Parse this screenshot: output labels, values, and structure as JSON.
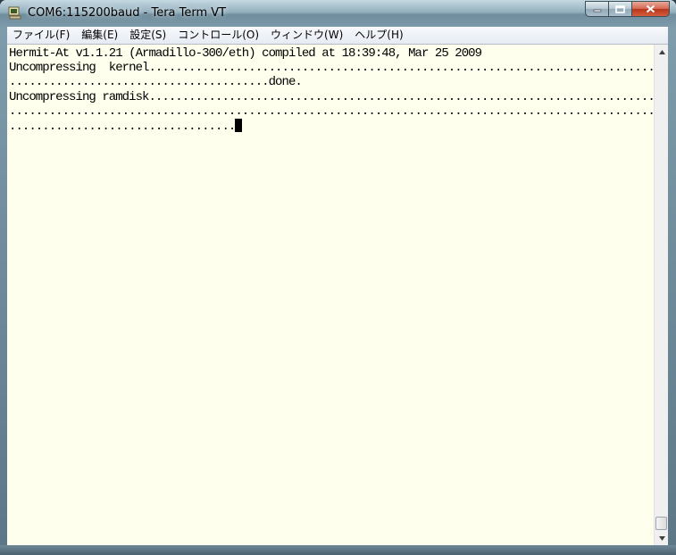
{
  "window": {
    "title": "COM6:115200baud - Tera Term VT",
    "icon": "tera-term-app-icon",
    "buttons": {
      "minimize_icon": "minimize-icon",
      "maximize_icon": "maximize-icon",
      "close_icon": "close-icon"
    }
  },
  "menu": [
    {
      "label": "ファイル(F)"
    },
    {
      "label": "編集(E)"
    },
    {
      "label": "設定(S)"
    },
    {
      "label": "コントロール(O)"
    },
    {
      "label": "ウィンドウ(W)"
    },
    {
      "label": "ヘルプ(H)"
    }
  ],
  "terminal": {
    "lines": [
      "Hermit-At v1.1.21 (Armadillo-300/eth) compiled at 18:39:48, Mar 25 2009",
      "Uncompressing  kernel.................................................................................................",
      ".......................................done.",
      "Uncompressing ramdisk.................................................................................................",
      "..................................................................................................................",
      ".................................."
    ],
    "cursor": "block",
    "colors": {
      "background": "#ffffee",
      "foreground": "#000000"
    }
  },
  "scrollbar": {
    "up_icon": "scroll-up-arrow-icon",
    "down_icon": "scroll-down-arrow-icon"
  }
}
